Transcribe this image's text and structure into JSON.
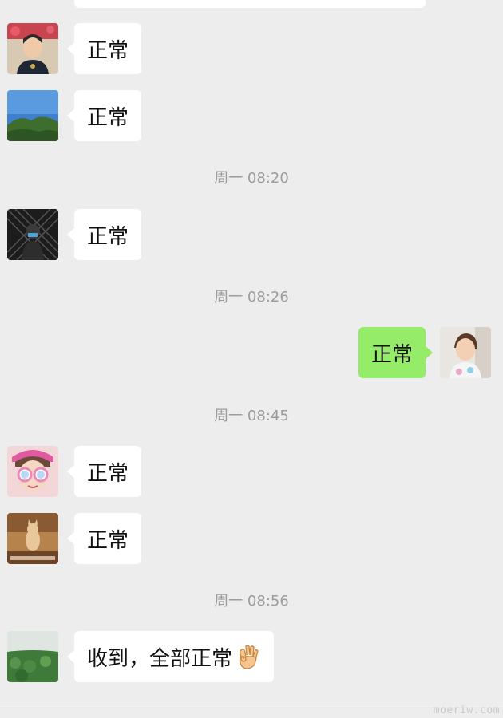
{
  "messages": [
    {
      "id": "m1",
      "side": "in",
      "text": "正常",
      "avatar": "avatar-woman-red-flowers"
    },
    {
      "id": "m2",
      "side": "in",
      "text": "正常",
      "avatar": "avatar-mountain-landscape"
    },
    {
      "id": "t1",
      "type": "time",
      "text": "周一 08:20"
    },
    {
      "id": "m3",
      "side": "in",
      "text": "正常",
      "avatar": "avatar-dark-person"
    },
    {
      "id": "t2",
      "type": "time",
      "text": "周一 08:26"
    },
    {
      "id": "m4",
      "side": "out",
      "text": "正常",
      "avatar": "avatar-child"
    },
    {
      "id": "t3",
      "type": "time",
      "text": "周一 08:45"
    },
    {
      "id": "m5",
      "side": "in",
      "text": "正常",
      "avatar": "avatar-girl-glasses"
    },
    {
      "id": "m6",
      "side": "in",
      "text": "正常",
      "avatar": "avatar-cat"
    },
    {
      "id": "t4",
      "type": "time",
      "text": "周一 08:56"
    },
    {
      "id": "m7",
      "side": "in",
      "text": "收到，全部正常",
      "emoji": "ok-hand-icon",
      "avatar": "avatar-lotus-field"
    }
  ],
  "watermark": "moeriw.com",
  "colors": {
    "background": "#ededed",
    "incoming_bubble": "#ffffff",
    "outgoing_bubble": "#95ec69",
    "timestamp": "#9c9c9c"
  }
}
